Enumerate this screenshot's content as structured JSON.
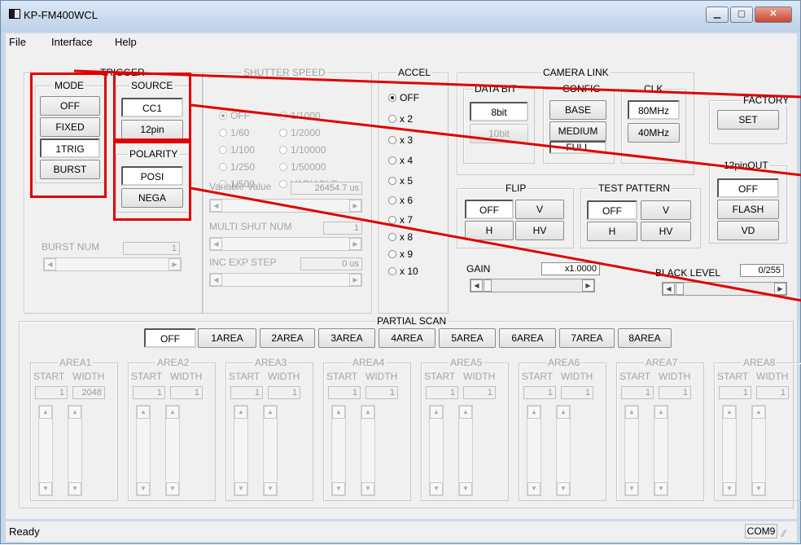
{
  "window": {
    "title": "KP-FM400WCL"
  },
  "menu": [
    "File",
    "Interface",
    "Help"
  ],
  "trigger": {
    "title": "TRIGGER",
    "mode_title": "MODE",
    "modes": [
      "OFF",
      "FIXED",
      "1TRIG",
      "BURST"
    ],
    "source_title": "SOURCE",
    "sources": [
      "CC1",
      "12pin"
    ],
    "polarity_title": "POLARITY",
    "polarities": [
      "POSI",
      "NEGA"
    ],
    "burst_num_label": "BURST NUM",
    "burst_num_value": "1"
  },
  "shutter": {
    "title": "SHUTTER SPEED",
    "options_col1": [
      "OFF",
      "1/60",
      "1/100",
      "1/250",
      "1/500"
    ],
    "options_col2": [
      "1/1000",
      "1/2000",
      "1/10000",
      "1/50000",
      "VARIABLE"
    ],
    "variable_label": "Variable Value",
    "variable_value": "26454.7 us",
    "multi_label": "MULTI SHUT NUM",
    "multi_value": "1",
    "inc_label": "INC EXP STEP",
    "inc_value": "0 us"
  },
  "accel": {
    "title": "ACCEL",
    "options": [
      "OFF",
      "x 2",
      "x 3",
      "x 4",
      "x 5",
      "x 6",
      "x 7",
      "x 8",
      "x 9",
      "x 10"
    ]
  },
  "camera_link": {
    "title": "CAMERA LINK",
    "data_bit_title": "DATA BIT",
    "data_bits": [
      "8bit",
      "10bit"
    ],
    "config_title": "CONFIG",
    "configs": [
      "BASE",
      "MEDIUM",
      "FULL"
    ],
    "clk_title": "CLK",
    "clks": [
      "80MHz",
      "40MHz"
    ]
  },
  "factory": {
    "title": "FACTORY",
    "set_label": "SET"
  },
  "pin_out": {
    "title": "12pinOUT",
    "options": [
      "OFF",
      "FLASH",
      "VD"
    ]
  },
  "flip": {
    "title": "FLIP",
    "options": [
      "OFF",
      "V",
      "H",
      "HV"
    ]
  },
  "test_pattern": {
    "title": "TEST PATTERN",
    "options": [
      "OFF",
      "V",
      "H",
      "HV"
    ]
  },
  "gain": {
    "label": "GAIN",
    "value": "x1.0000"
  },
  "black_level": {
    "label": "BLACK LEVEL",
    "value": "0/255"
  },
  "partial_scan": {
    "title": "PARTIAL SCAN",
    "buttons": [
      "OFF",
      "1AREA",
      "2AREA",
      "3AREA",
      "4AREA",
      "5AREA",
      "6AREA",
      "7AREA",
      "8AREA"
    ],
    "start_label": "START",
    "width_label": "WIDTH",
    "areas": [
      {
        "name": "AREA1",
        "start": "1",
        "width": "2048"
      },
      {
        "name": "AREA2",
        "start": "1",
        "width": "1"
      },
      {
        "name": "AREA3",
        "start": "1",
        "width": "1"
      },
      {
        "name": "AREA4",
        "start": "1",
        "width": "1"
      },
      {
        "name": "AREA5",
        "start": "1",
        "width": "1"
      },
      {
        "name": "AREA6",
        "start": "1",
        "width": "1"
      },
      {
        "name": "AREA7",
        "start": "1",
        "width": "1"
      },
      {
        "name": "AREA8",
        "start": "1",
        "width": "1"
      }
    ]
  },
  "status": {
    "text": "Ready",
    "port": "COM9"
  }
}
